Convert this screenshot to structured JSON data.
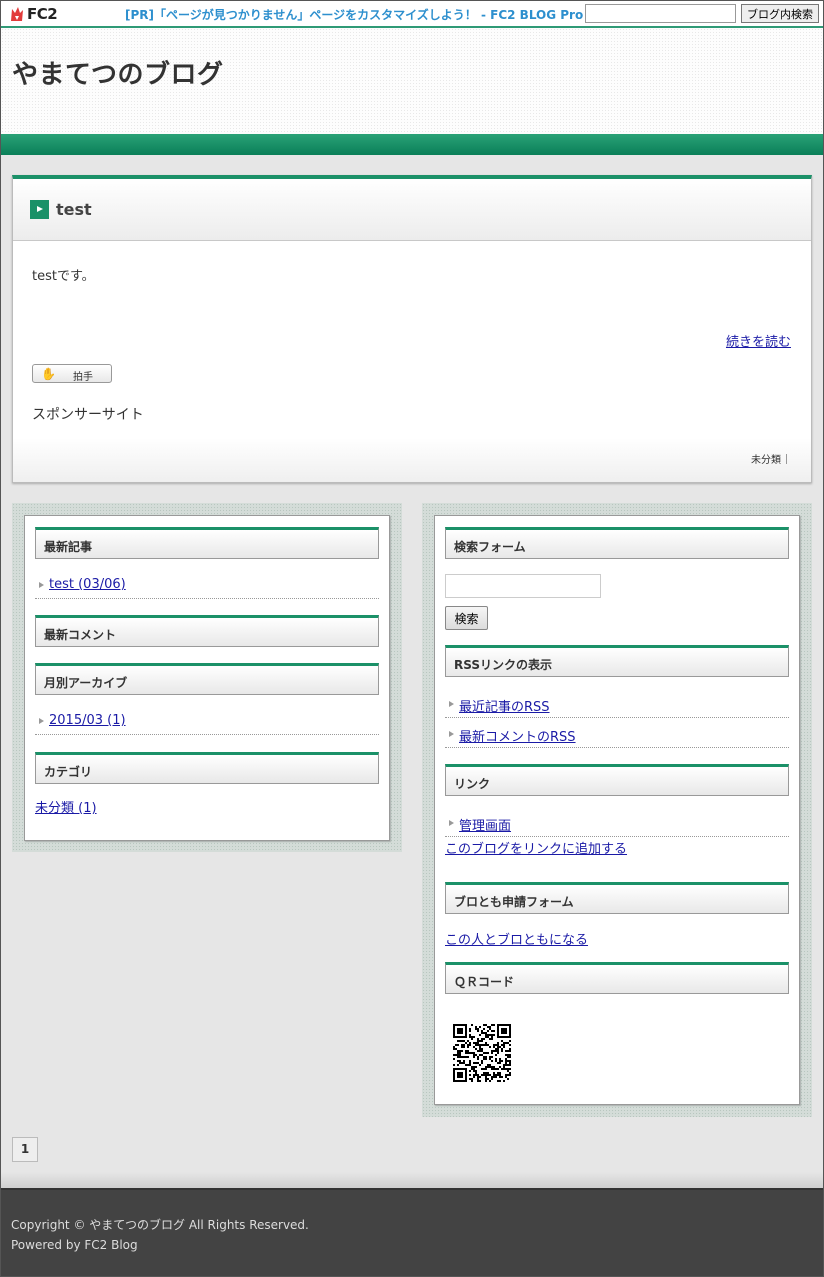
{
  "topbar": {
    "logo_text": "FC2",
    "pr_text": "[PR]「ページが見つかりません」ページをカスタマイズしよう！ - FC2 BLOG Pro",
    "search_value": "",
    "search_button": "ブログ内検索"
  },
  "header": {
    "blog_title": "やまてつのブログ"
  },
  "entry": {
    "title": "test",
    "body": "testです。",
    "more_link": "続きを読む",
    "clap_label": "拍手",
    "sponsor": "スポンサーサイト",
    "category": "未分類"
  },
  "left_sidebar": {
    "recent_entries": {
      "title": "最新記事",
      "items": [
        "test (03/06)"
      ]
    },
    "recent_comments": {
      "title": "最新コメント"
    },
    "monthly_archive": {
      "title": "月別アーカイブ",
      "items": [
        "2015/03 (1)"
      ]
    },
    "categories": {
      "title": "カテゴリ",
      "items": [
        "未分類 (1)"
      ]
    }
  },
  "right_sidebar": {
    "search_form": {
      "title": "検索フォーム",
      "input_value": "",
      "button": "検索"
    },
    "rss": {
      "title": "RSSリンクの表示",
      "items": [
        "最近記事のRSS",
        "最新コメントのRSS"
      ]
    },
    "links": {
      "title": "リンク",
      "items": [
        "管理画面"
      ],
      "add_link": "このブログをリンクに追加する"
    },
    "bromo": {
      "title": "ブロとも申請フォーム",
      "link": "この人とブロともになる"
    },
    "qr": {
      "title": "ＱＲコード"
    }
  },
  "pager": {
    "current": "1"
  },
  "footer": {
    "copyright": "Copyright © やまてつのブログ All Rights Reserved.",
    "powered": "Powered by FC2 Blog"
  },
  "colors": {
    "accent_green": "#1b9168",
    "pr_blue": "#2d8fce",
    "link": "#1a1aa6",
    "footer_bg": "#434343"
  }
}
